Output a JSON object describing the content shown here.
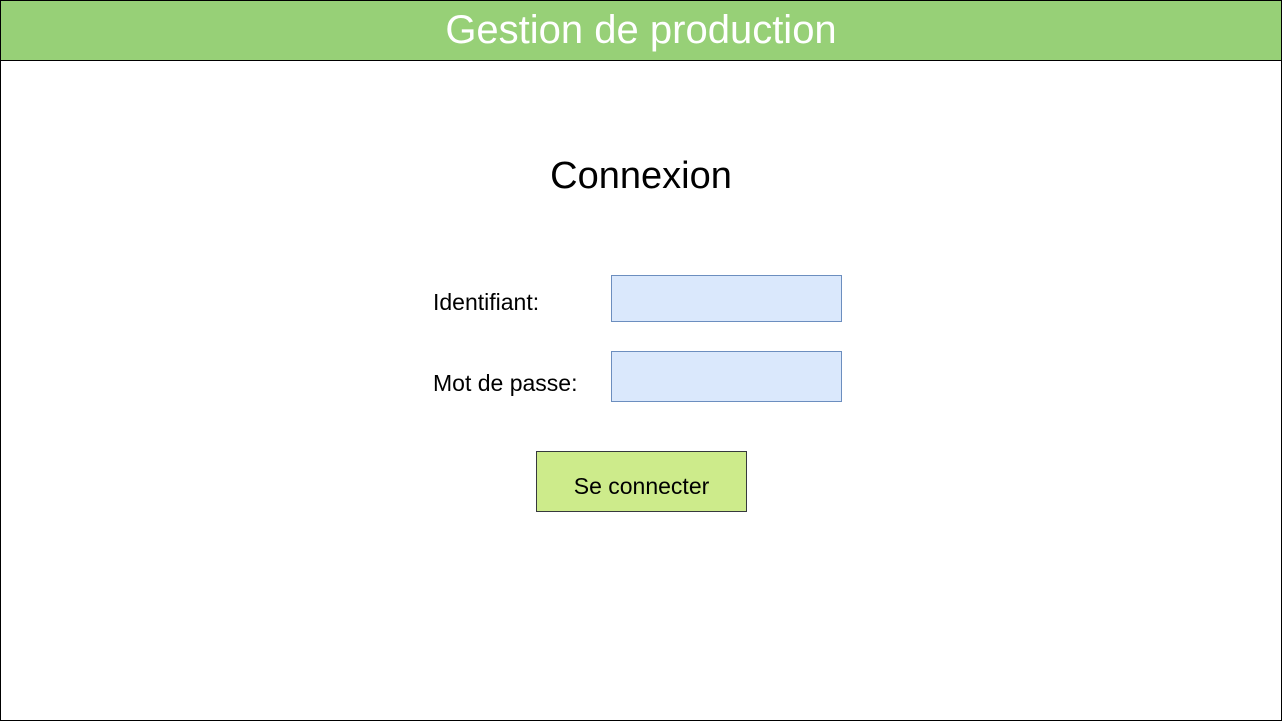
{
  "header": {
    "title": "Gestion de production",
    "background_color": "#97d077"
  },
  "login": {
    "title": "Connexion",
    "username_label": "Identifiant:",
    "username_value": "",
    "password_label": "Mot de passe:",
    "password_value": "",
    "submit_label": "Se connecter",
    "field_color": "#dae8fc",
    "button_color": "#cdeb8b"
  }
}
